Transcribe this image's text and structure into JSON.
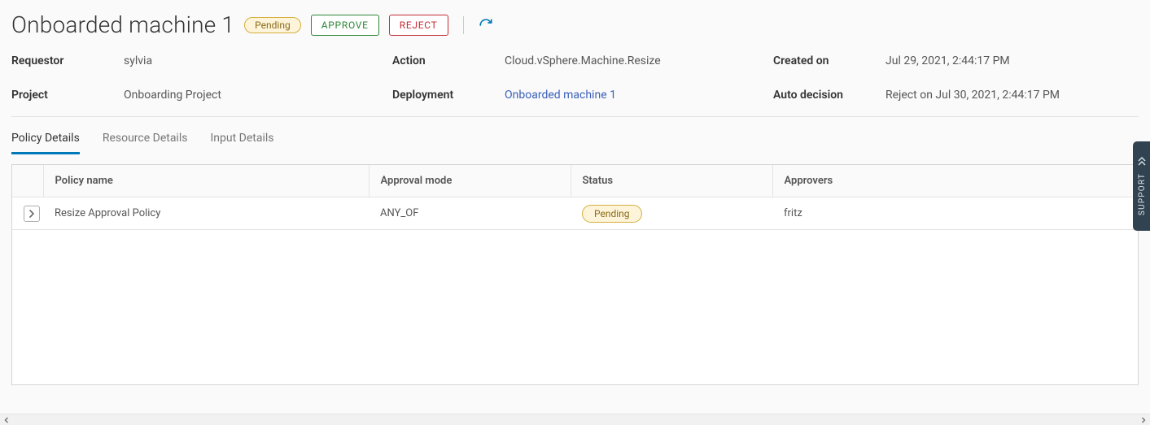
{
  "header": {
    "title": "Onboarded machine 1",
    "status": "Pending",
    "approve_label": "APPROVE",
    "reject_label": "REJECT"
  },
  "summary": {
    "requestor": {
      "label": "Requestor",
      "value": "sylvia"
    },
    "action": {
      "label": "Action",
      "value": "Cloud.vSphere.Machine.Resize"
    },
    "created_on": {
      "label": "Created on",
      "value": "Jul 29, 2021, 2:44:17 PM"
    },
    "project": {
      "label": "Project",
      "value": "Onboarding Project"
    },
    "deployment": {
      "label": "Deployment",
      "value": "Onboarded machine 1"
    },
    "auto_decision": {
      "label": "Auto decision",
      "value": "Reject on Jul 30, 2021, 2:44:17 PM"
    }
  },
  "tabs": {
    "policy_details": "Policy Details",
    "resource_details": "Resource Details",
    "input_details": "Input Details"
  },
  "grid": {
    "columns": {
      "policy_name": "Policy name",
      "approval_mode": "Approval mode",
      "status": "Status",
      "approvers": "Approvers"
    },
    "rows": [
      {
        "policy_name": "Resize Approval Policy",
        "approval_mode": "ANY_OF",
        "status": "Pending",
        "approvers": "fritz"
      }
    ]
  },
  "support": {
    "label": "SUPPORT"
  }
}
